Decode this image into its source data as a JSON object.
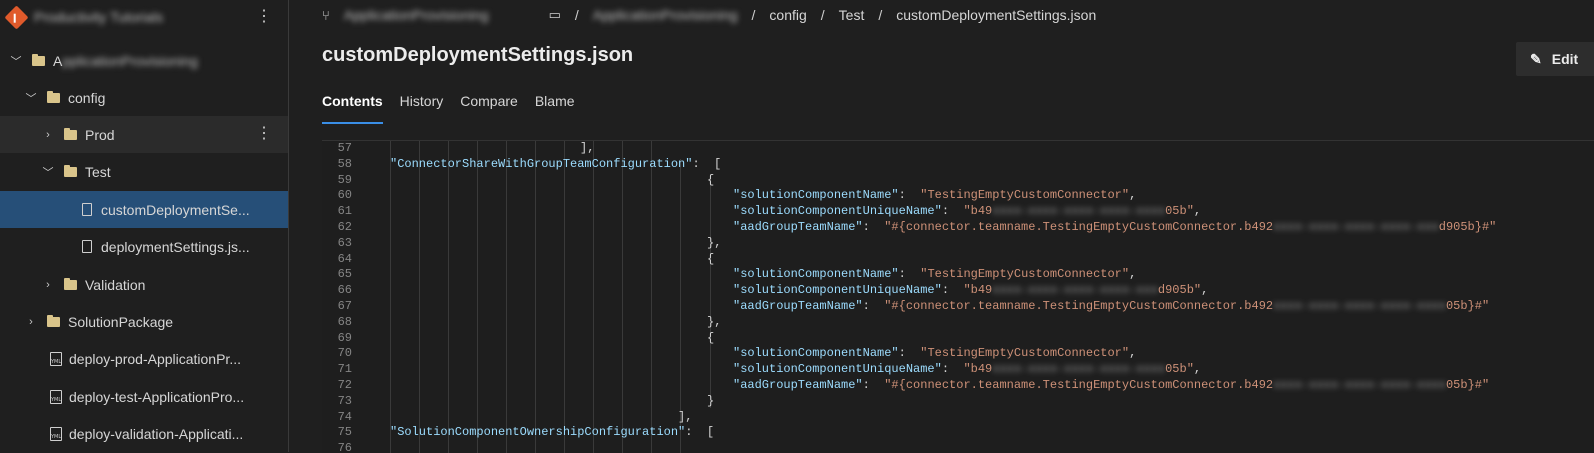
{
  "sidebar": {
    "repo_name": "Productivity Tutorials",
    "items": [
      {
        "label": "ApplicationProvisioning",
        "blurred_part": "pplicationProvisioning",
        "prefix": "A"
      },
      {
        "label": "config"
      },
      {
        "label": "Prod"
      },
      {
        "label": "Test"
      },
      {
        "label": "customDeploymentSe..."
      },
      {
        "label": "deploymentSettings.js..."
      },
      {
        "label": "Validation"
      },
      {
        "label": "SolutionPackage"
      },
      {
        "label": "deploy-prod-ApplicationPr..."
      },
      {
        "label": "deploy-test-ApplicationPro..."
      },
      {
        "label": "deploy-validation-Applicati..."
      }
    ]
  },
  "breadcrumb": {
    "branch": "ApplicationProvisioning",
    "root": "ApplicationProvisioning",
    "config": "config",
    "test": "Test",
    "file": "customDeploymentSettings.json",
    "sep": "/"
  },
  "file_title": "customDeploymentSettings.json",
  "edit_button": "Edit",
  "tabs": [
    "Contents",
    "History",
    "Compare",
    "Blame"
  ],
  "code": {
    "ln57": "57",
    "l57": "],",
    "ln58": "58",
    "k58": "\"ConnectorShareWithGroupTeamConfiguration\"",
    "p58": ":  [",
    "ln59": "59",
    "l59": "{",
    "ln60": "60",
    "k60": "\"solutionComponentName\"",
    "s60": "\"TestingEmptyCustomConnector\"",
    "ln61": "61",
    "k61": "\"solutionComponentUniqueName\"",
    "s61a": "\"b49",
    "s61r": "xxxx-xxxx-xxxx-xxxx-xxxx",
    "s61b": "05b\"",
    "ln62": "62",
    "k62": "\"aadGroupTeamName\"",
    "s62a": "\"#{connector.teamname.TestingEmptyCustomConnector.b492",
    "s62r": "xxxx-xxxx-xxxx-xxxx-xxx",
    "s62b": "d905b}#\"",
    "ln63": "63",
    "l63": "},",
    "ln64": "64",
    "l64": "{",
    "ln65": "65",
    "k65": "\"solutionComponentName\"",
    "s65": "\"TestingEmptyCustomConnector\"",
    "ln66": "66",
    "k66": "\"solutionComponentUniqueName\"",
    "s66a": "\"b49",
    "s66r": "xxxx-xxxx-xxxx-xxxx-xxx",
    "s66b": "d905b\"",
    "ln67": "67",
    "k67": "\"aadGroupTeamName\"",
    "s67a": "\"#{connector.teamname.TestingEmptyCustomConnector.b492",
    "s67r": "xxxx-xxxx-xxxx-xxxx-xxxx",
    "s67b": "05b}#\"",
    "ln68": "68",
    "l68": "},",
    "ln69": "69",
    "l69": "{",
    "ln70": "70",
    "k70": "\"solutionComponentName\"",
    "s70": "\"TestingEmptyCustomConnector\"",
    "ln71": "71",
    "k71": "\"solutionComponentUniqueName\"",
    "s71a": "\"b49",
    "s71r": "xxxx-xxxx-xxxx-xxxx-xxxx",
    "s71b": "05b\"",
    "ln72": "72",
    "k72": "\"aadGroupTeamName\"",
    "s72a": "\"#{connector.teamname.TestingEmptyCustomConnector.b492",
    "s72r": "xxxx-xxxx-xxxx-xxxx-xxxx",
    "s72b": "05b}#\"",
    "ln73": "73",
    "l73": "}",
    "ln74": "74",
    "l74": "],",
    "ln75": "75",
    "k75": "\"SolutionComponentOwnershipConfiguration\"",
    "p75": ":  [",
    "ln76": "76"
  }
}
